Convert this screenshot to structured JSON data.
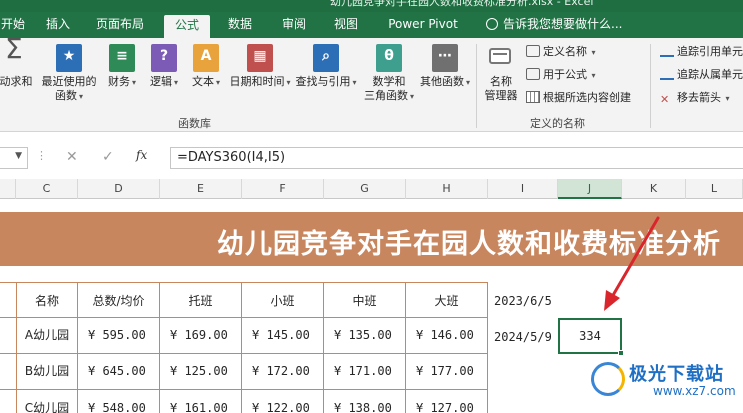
{
  "window": {
    "title": "幼儿园竞争对手在园人数和收费标准分析.xlsx - Excel"
  },
  "tabs": [
    "开始",
    "插入",
    "页面布局",
    "公式",
    "数据",
    "审阅",
    "视图",
    "Power Pivot"
  ],
  "active_tab": "公式",
  "tell_me": "告诉我您想要做什么...",
  "ribbon": {
    "function_library": {
      "autosum": "动求和",
      "recent_1": "最近使用的",
      "recent_2": "函数",
      "financial": "财务",
      "logical": "逻辑",
      "text": "文本",
      "datetime": "日期和时间",
      "lookup": "查找与引用",
      "math_1": "数学和",
      "math_2": "三角函数",
      "more": "其他函数",
      "label": "函数库"
    },
    "defined_names": {
      "manager_1": "名称",
      "manager_2": "管理器",
      "define_name": "定义名称",
      "use_in_formula": "用于公式",
      "create_from_selection": "根据所选内容创建",
      "label": "定义的名称"
    },
    "auditing": {
      "trace_precedents": "追踪引用单元",
      "trace_dependents": "追踪从属单元",
      "remove_arrows": "移去箭头"
    },
    "icon_letters": {
      "logical": "?",
      "text": "A",
      "math": "θ",
      "sigma": "Σ"
    }
  },
  "formula_bar": {
    "cancel": "✕",
    "enter": "✓",
    "fx": "fx",
    "formula": "=DAYS360(I4,I5)"
  },
  "columns": [
    "C",
    "D",
    "E",
    "F",
    "G",
    "H",
    "I",
    "J",
    "K",
    "L"
  ],
  "active_column": "J",
  "sheet": {
    "title": "幼儿园竞争对手在园人数和收费标准分析",
    "headers": [
      "名称",
      "总数/均价",
      "托班",
      "小班",
      "中班",
      "大班"
    ],
    "rows": [
      {
        "name": "A幼儿园",
        "values": [
          "¥ 595.00",
          "¥ 169.00",
          "¥ 145.00",
          "¥ 135.00",
          "¥ 146.00"
        ]
      },
      {
        "name": "B幼儿园",
        "values": [
          "¥ 645.00",
          "¥ 125.00",
          "¥ 172.00",
          "¥ 171.00",
          "¥ 177.00"
        ]
      },
      {
        "name": "C幼儿园",
        "values": [
          "¥ 548.00",
          "¥ 161.00",
          "¥ 122.00",
          "¥ 138.00",
          "¥ 127.00"
        ]
      }
    ],
    "date1": "2023/6/5",
    "date2": "2024/5/9",
    "result": "334"
  },
  "watermark": {
    "name": "极光下载站",
    "url": "www.xz7.com"
  },
  "colors": {
    "excel_green": "#217346",
    "banner": "#c8865f",
    "arrow": "#d9262c"
  }
}
